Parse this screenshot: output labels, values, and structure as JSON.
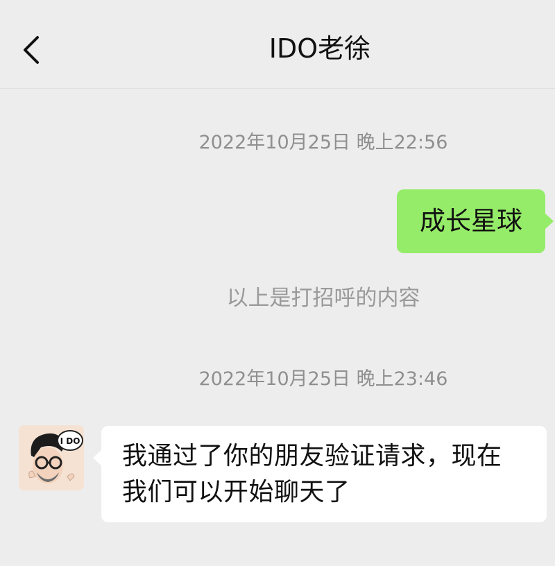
{
  "header": {
    "title": "IDO老徐",
    "back_icon": "chevron-left-icon"
  },
  "messages": [
    {
      "type": "timestamp",
      "text": "2022年10月25日 晚上22:56"
    },
    {
      "type": "sent",
      "text": "成长星球",
      "bubble_color": "#95ec69"
    },
    {
      "type": "system",
      "text": "以上是打招呼的内容"
    },
    {
      "type": "timestamp",
      "text": "2022年10月25日 晚上23:46"
    },
    {
      "type": "received",
      "lines": [
        "我通过了你的朋友验证请求，现在",
        "我们可以开始聊天了"
      ],
      "avatar_text": "I DO",
      "bubble_color": "#ffffff"
    }
  ],
  "colors": {
    "background": "#ededed",
    "sent_bubble": "#95ec69",
    "received_bubble": "#ffffff"
  }
}
